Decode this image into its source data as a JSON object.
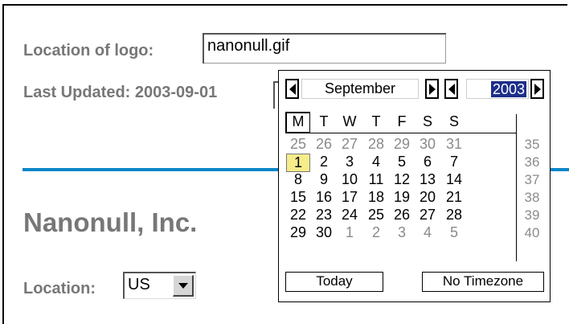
{
  "form": {
    "logo_label": "Location of logo:",
    "logo_value": "nanonull.gif",
    "updated_label": "Last Updated: 2003-09-01",
    "company_name": "Nanonull, Inc.",
    "location_label": "Location:",
    "location_value": "US"
  },
  "calendar": {
    "month": "September",
    "year": "2003",
    "weekdays": [
      "M",
      "T",
      "W",
      "T",
      "F",
      "S",
      "S"
    ],
    "weeks": [
      {
        "week": "35",
        "days": [
          [
            "25",
            1
          ],
          [
            "26",
            1
          ],
          [
            "27",
            1
          ],
          [
            "28",
            1
          ],
          [
            "29",
            1
          ],
          [
            "30",
            1
          ],
          [
            "31",
            1
          ]
        ]
      },
      {
        "week": "36",
        "days": [
          [
            "1",
            0
          ],
          [
            "2",
            0
          ],
          [
            "3",
            0
          ],
          [
            "4",
            0
          ],
          [
            "5",
            0
          ],
          [
            "6",
            0
          ],
          [
            "7",
            0
          ]
        ]
      },
      {
        "week": "37",
        "days": [
          [
            "8",
            0
          ],
          [
            "9",
            0
          ],
          [
            "10",
            0
          ],
          [
            "11",
            0
          ],
          [
            "12",
            0
          ],
          [
            "13",
            0
          ],
          [
            "14",
            0
          ]
        ]
      },
      {
        "week": "38",
        "days": [
          [
            "15",
            0
          ],
          [
            "16",
            0
          ],
          [
            "17",
            0
          ],
          [
            "18",
            0
          ],
          [
            "19",
            0
          ],
          [
            "20",
            0
          ],
          [
            "21",
            0
          ]
        ]
      },
      {
        "week": "39",
        "days": [
          [
            "22",
            0
          ],
          [
            "23",
            0
          ],
          [
            "24",
            0
          ],
          [
            "25",
            0
          ],
          [
            "26",
            0
          ],
          [
            "27",
            0
          ],
          [
            "28",
            0
          ]
        ]
      },
      {
        "week": "40",
        "days": [
          [
            "29",
            0
          ],
          [
            "30",
            0
          ],
          [
            "1",
            1
          ],
          [
            "2",
            1
          ],
          [
            "3",
            1
          ],
          [
            "4",
            1
          ],
          [
            "5",
            1
          ]
        ]
      }
    ],
    "selected_day": "1",
    "today_label": "Today",
    "no_timezone_label": "No Timezone"
  },
  "colors": {
    "accent_rule": "#0a86c9",
    "label_gray": "#777777",
    "selected_day_bg": "#f6ec8a",
    "year_highlight": "#1c2e8a"
  }
}
